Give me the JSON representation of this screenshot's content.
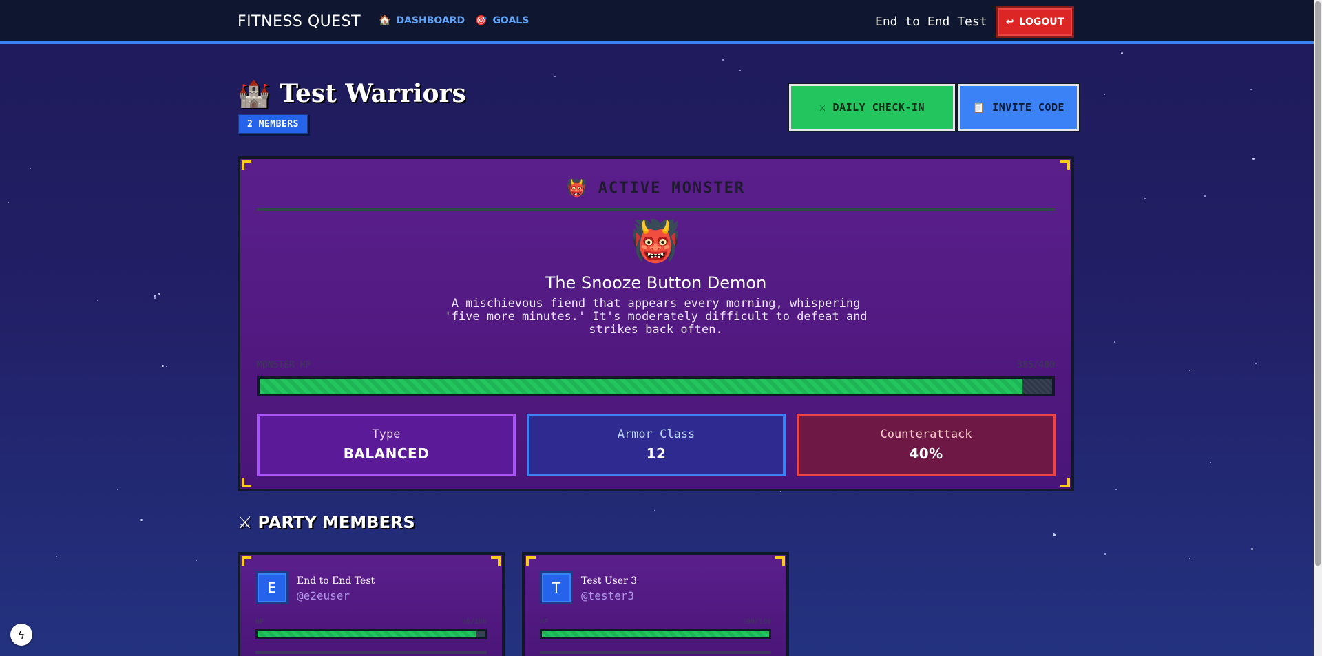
{
  "nav": {
    "brand": "FITNESS QUEST",
    "links": [
      {
        "label": "DASHBOARD",
        "icon": "🏠"
      },
      {
        "label": "GOALS",
        "icon": "🎯"
      }
    ],
    "user_name": "End to End Test",
    "logout_label": "LOGOUT",
    "logout_icon": "↩"
  },
  "party": {
    "icon": "🏰",
    "name": "Test Warriors",
    "members_badge": "2 MEMBERS",
    "checkin_icon": "⚔",
    "checkin_label": "DAILY CHECK-IN",
    "invite_icon": "📋",
    "invite_label": "INVITE CODE"
  },
  "monster": {
    "heading_icon": "👹",
    "heading": "ACTIVE MONSTER",
    "face": "👹",
    "name": "The Snooze Button Demon",
    "description": "A mischievous fiend that appears every morning, whispering 'five more minutes.' It's moderately difficult to defeat and strikes back often.",
    "hp_label": "MONSTER HP",
    "hp_text": "385/400",
    "hp_fraction": 0.9625,
    "stats": [
      {
        "label": "Type",
        "value": "BALANCED"
      },
      {
        "label": "Armor Class",
        "value": "12"
      },
      {
        "label": "Counterattack",
        "value": "40%"
      }
    ]
  },
  "members_section": {
    "icon": "⚔",
    "heading": "PARTY MEMBERS",
    "members": [
      {
        "initial": "E",
        "name": "End to End Test",
        "handle": "@e2euser",
        "hp_label": "HP",
        "hp_text": "96/100",
        "hp_fraction": 0.96
      },
      {
        "initial": "T",
        "name": "Test User 3",
        "handle": "@tester3",
        "hp_label": "HP",
        "hp_text": "100/100",
        "hp_fraction": 1.0
      }
    ]
  },
  "colors": {
    "accent_blue": "#3b82f6",
    "success_green": "#22c55e",
    "danger_red": "#dc2626",
    "corner_gold": "#facc15"
  }
}
